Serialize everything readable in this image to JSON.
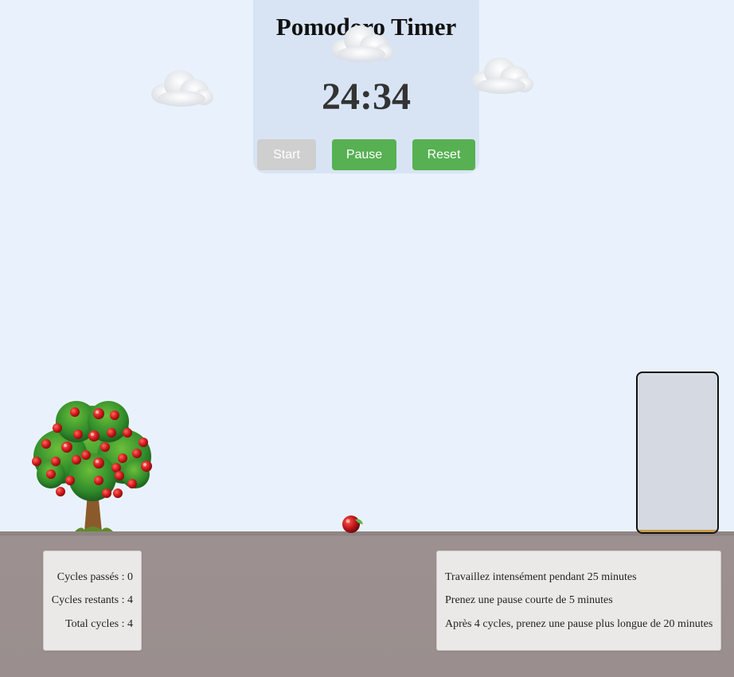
{
  "timer": {
    "title": "Pomodoro Timer",
    "display": "24:34",
    "start_label": "Start",
    "pause_label": "Pause",
    "reset_label": "Reset"
  },
  "stats": {
    "cycles_passed": "Cycles passés : 0",
    "cycles_remaining": "Cycles restants : 4",
    "total_cycles": "Total cycles : 4"
  },
  "info": {
    "line1": "Travaillez intensément pendant 25 minutes",
    "line2": "Prenez une pause courte de 5 minutes",
    "line3": "Après 4 cycles, prenez une pause plus longue de 20 minutes"
  },
  "basket": {
    "fill_fraction": 0
  },
  "colors": {
    "sky": "#e9f2fc",
    "ground": "#9a8f8e",
    "button_active": "#57b052",
    "button_disabled": "#cfcfcf",
    "timer_card": "#d8e4f4",
    "apple": "#c0161c",
    "leaf": "#3a8a2a"
  },
  "icons": [
    "cloud-icon",
    "apple-tree-icon",
    "apple-icon",
    "basket-icon"
  ]
}
